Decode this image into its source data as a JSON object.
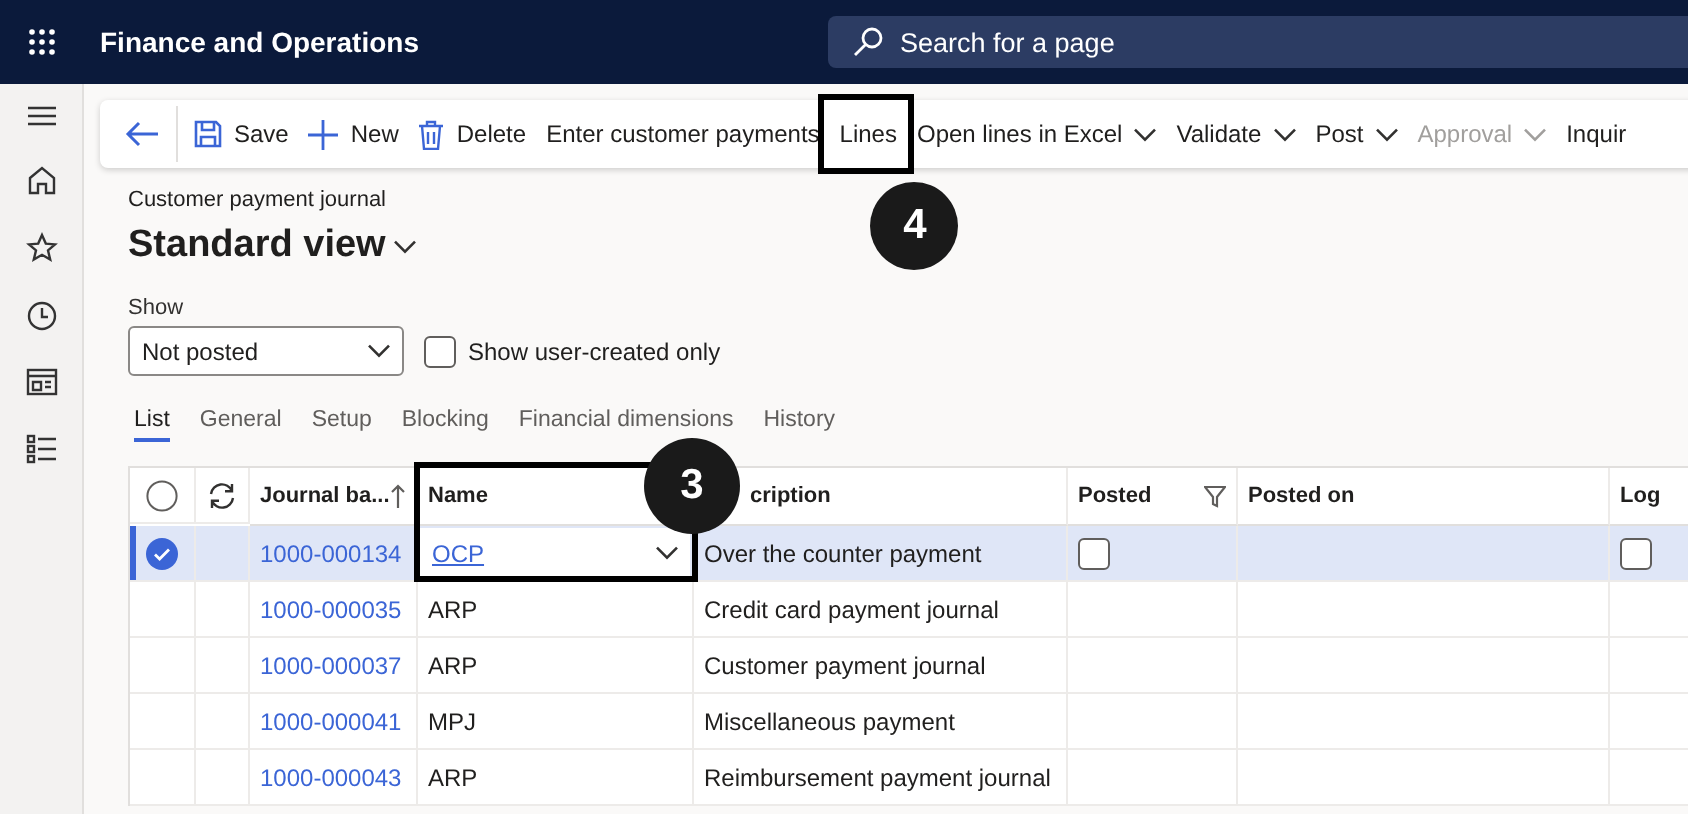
{
  "app": {
    "title": "Finance and Operations",
    "search_placeholder": "Search for a page"
  },
  "toolbar": [
    {
      "kind": "back",
      "disabled": false
    },
    {
      "kind": "save",
      "label": "Save",
      "disabled": false
    },
    {
      "kind": "add",
      "label": "New",
      "disabled": false
    },
    {
      "kind": "delete",
      "label": "Delete",
      "disabled": false
    },
    {
      "kind": "plain",
      "label": "Enter customer payments",
      "disabled": false
    },
    {
      "kind": "plain",
      "label": "Lines",
      "disabled": false,
      "callout": "4"
    },
    {
      "kind": "menu",
      "label": "Open lines in Excel",
      "disabled": false
    },
    {
      "kind": "menu",
      "label": "Validate",
      "disabled": false
    },
    {
      "kind": "menu",
      "label": "Post",
      "disabled": false
    },
    {
      "kind": "menu",
      "label": "Approval",
      "disabled": true
    },
    {
      "kind": "plain",
      "label": "Inquir",
      "disabled": false
    }
  ],
  "page": {
    "caption": "Customer payment journal",
    "view": "Standard view"
  },
  "filter": {
    "label": "Show",
    "value": "Not posted",
    "checkbox_label": "Show user-created only",
    "checked": false
  },
  "tabs": [
    {
      "label": "List",
      "selected": true
    },
    {
      "label": "General",
      "selected": false
    },
    {
      "label": "Setup",
      "selected": false
    },
    {
      "label": "Blocking",
      "selected": false
    },
    {
      "label": "Financial dimensions",
      "selected": false
    },
    {
      "label": "History",
      "selected": false
    }
  ],
  "grid": {
    "columns": [
      {
        "kind": "select"
      },
      {
        "kind": "refresh"
      },
      {
        "kind": "sorted",
        "label": "Journal ba..."
      },
      {
        "kind": "text",
        "label": "Name",
        "callout": "3"
      },
      {
        "kind": "text",
        "label": "cription"
      },
      {
        "kind": "filtered",
        "label": "Posted"
      },
      {
        "kind": "text",
        "label": "Posted on"
      },
      {
        "kind": "text",
        "label": "Log"
      }
    ],
    "rows": [
      {
        "selected": true,
        "batch": "1000-000134",
        "name": "OCP",
        "description": "Over the counter payment",
        "posted": false,
        "log": false
      },
      {
        "selected": false,
        "batch": "1000-000035",
        "name": "ARP",
        "description": "Credit card payment journal"
      },
      {
        "selected": false,
        "batch": "1000-000037",
        "name": "ARP",
        "description": "Customer payment journal"
      },
      {
        "selected": false,
        "batch": "1000-000041",
        "name": "MPJ",
        "description": "Miscellaneous payment"
      },
      {
        "selected": false,
        "batch": "1000-000043",
        "name": "ARP",
        "description": "Reimbursement payment journal"
      }
    ]
  }
}
